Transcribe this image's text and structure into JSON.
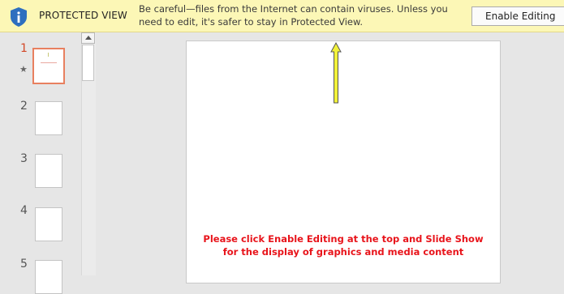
{
  "protected_view": {
    "title": "PROTECTED VIEW",
    "message_line1": "Be careful—files from the Internet can contain viruses. Unless you",
    "message_line2": "need to edit, it's safer to stay in Protected View.",
    "enable_button": "Enable Editing",
    "icon": "shield-info-icon",
    "bar_color": "#fcf7b6"
  },
  "thumbnails": {
    "slides": [
      {
        "number": "1",
        "selected": true,
        "has_transition_star": true
      },
      {
        "number": "2",
        "selected": false
      },
      {
        "number": "3",
        "selected": false
      },
      {
        "number": "4",
        "selected": false
      },
      {
        "number": "5",
        "selected": false
      }
    ],
    "star_glyph": "★",
    "selected_color": "#e8805f"
  },
  "slide": {
    "text_line1": "Please click Enable Editing at the top and Slide Show",
    "text_line2": "for the display of graphics and media content",
    "text_color": "#e8141b",
    "arrow_color": "#f2f23a",
    "arrow_icon": "up-arrow-icon"
  }
}
